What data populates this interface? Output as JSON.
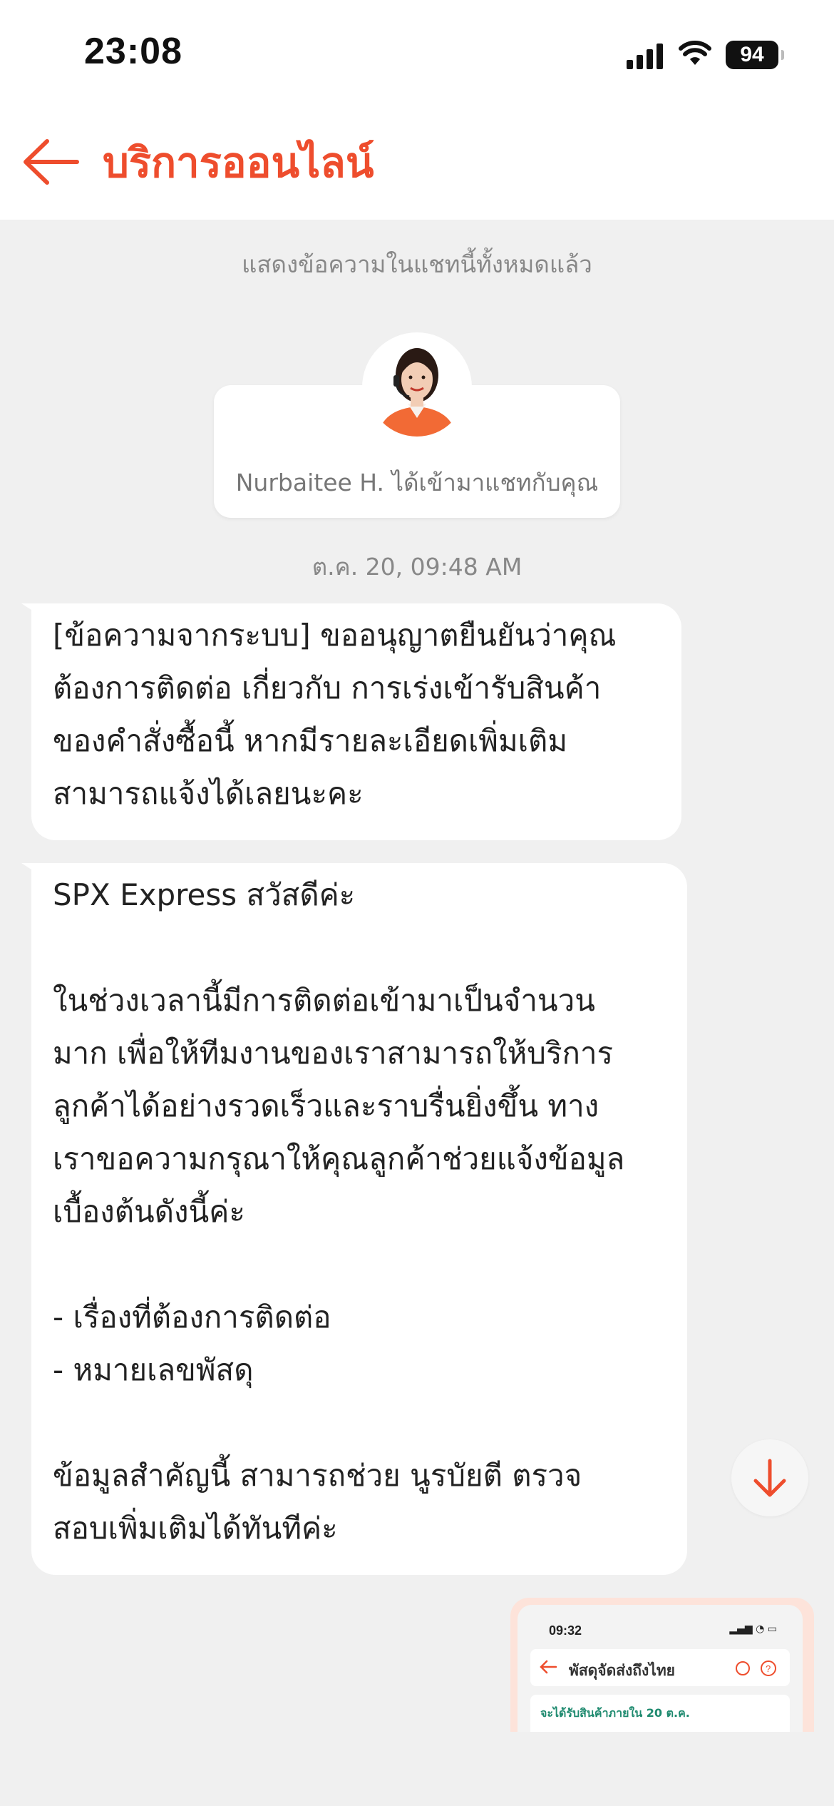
{
  "status_bar": {
    "time": "23:08",
    "battery": "94"
  },
  "header": {
    "title": "บริการออนไลน์"
  },
  "chat": {
    "notice": "แสดงข้อความในแชทนี้ทั้งหมดแล้ว",
    "agent_joined": "Nurbaitee H. ได้เข้ามาแชทกับคุณ",
    "timestamp": "ต.ค. 20, 09:48 AM",
    "messages": [
      {
        "text": "[ข้อความจากระบบ] ขออนุญาตยืนยันว่าคุณ\nต้องการติดต่อ เกี่ยวกับ การเร่งเข้ารับสินค้า\nของคำสั่งซื้อนี้ หากมีรายละเอียดเพิ่มเติม\nสามารถแจ้งได้เลยนะคะ"
      },
      {
        "text": "SPX Express สวัสดีค่ะ\n\nในช่วงเวลานี้มีการติดต่อเข้ามาเป็นจำนวน\nมาก เพื่อให้ทีมงานของเราสามารถให้บริการ\nลูกค้าได้อย่างรวดเร็วและราบรื่นยิ่งขึ้น ทาง\nเราขอความกรุณาให้คุณลูกค้าช่วยแจ้งข้อมูล\nเบื้องต้นดังนี้ค่ะ\n\n- เรื่องที่ต้องการติดต่อ\n- หมายเลขพัสดุ\n\nข้อมูลสำคัญนี้ สามารถช่วย นูรบัยตี ตรวจ\nสอบเพิ่มเติมได้ทันทีค่ะ"
      }
    ],
    "image_preview": {
      "time": "09:32",
      "title": "พัสดุจัดส่งถึงไทย",
      "delivery_note": "จะได้รับสินค้าภายใน 20 ต.ค."
    }
  },
  "colors": {
    "accent": "#ee4d2d",
    "bubble": "#ffffff",
    "background": "#f0f0f0"
  }
}
